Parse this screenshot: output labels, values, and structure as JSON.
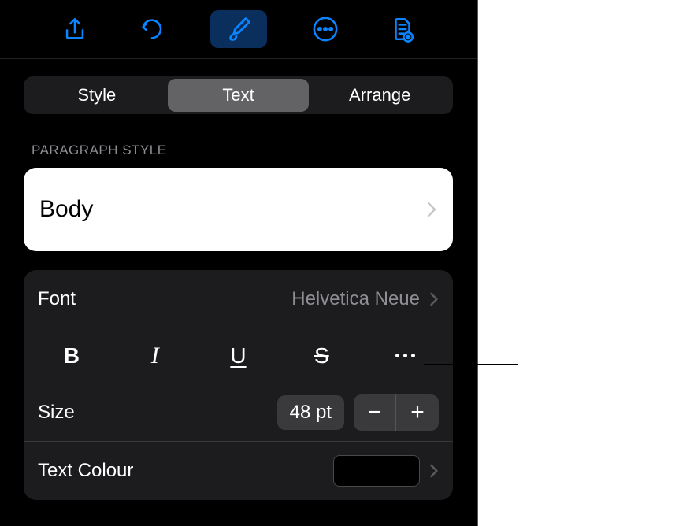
{
  "toolbar": {
    "icons": [
      "share",
      "undo",
      "format",
      "more",
      "document"
    ]
  },
  "tabs": {
    "items": [
      {
        "label": "Style"
      },
      {
        "label": "Text"
      },
      {
        "label": "Arrange"
      }
    ],
    "active_index": 1
  },
  "paragraph_style": {
    "section_label": "PARAGRAPH STYLE",
    "value": "Body"
  },
  "font": {
    "label": "Font",
    "value": "Helvetica Neue"
  },
  "text_styles": {
    "bold": "B",
    "italic": "I",
    "underline": "U",
    "strike": "S"
  },
  "size": {
    "label": "Size",
    "value": "48 pt",
    "minus": "−",
    "plus": "+"
  },
  "text_colour": {
    "label": "Text Colour",
    "value": "#000000"
  }
}
